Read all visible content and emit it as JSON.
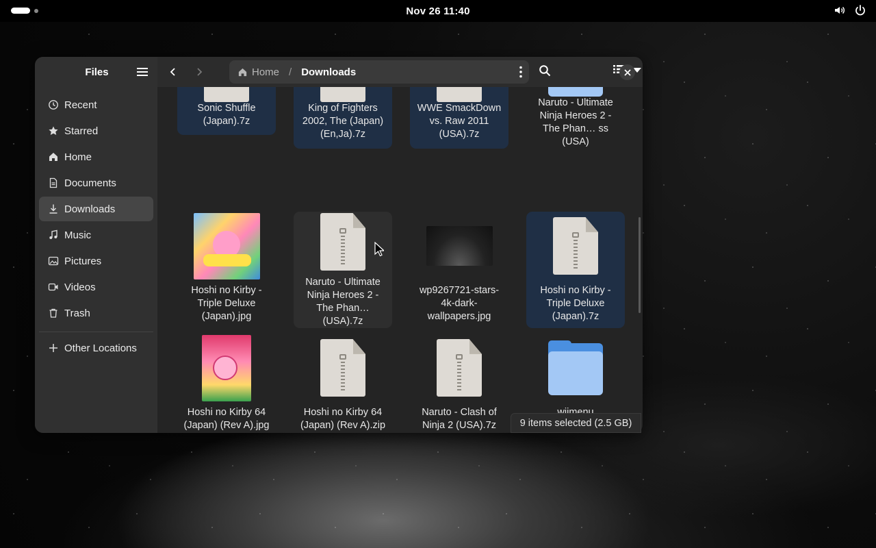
{
  "topbar": {
    "clock": "Nov 26  11:40"
  },
  "sidebar": {
    "title": "Files",
    "items": [
      {
        "label": "Recent",
        "icon": "clock-icon"
      },
      {
        "label": "Starred",
        "icon": "star-icon"
      },
      {
        "label": "Home",
        "icon": "home-icon"
      },
      {
        "label": "Documents",
        "icon": "document-icon"
      },
      {
        "label": "Downloads",
        "icon": "download-icon",
        "active": true
      },
      {
        "label": "Music",
        "icon": "music-icon"
      },
      {
        "label": "Pictures",
        "icon": "picture-icon"
      },
      {
        "label": "Videos",
        "icon": "video-icon"
      },
      {
        "label": "Trash",
        "icon": "trash-icon"
      }
    ],
    "other_locations": "Other Locations"
  },
  "header": {
    "breadcrumb_home": "Home",
    "breadcrumb_sep": "/",
    "breadcrumb_current": "Downloads"
  },
  "files": [
    {
      "label": "Sonic Shuffle (Japan).7z",
      "type": "archive",
      "selected": true
    },
    {
      "label": "King of Fighters 2002, The (Japan) (En,Ja).7z",
      "type": "archive",
      "selected": true
    },
    {
      "label": "WWE SmackDown vs. Raw 2011 (USA).7z",
      "type": "archive",
      "selected": true
    },
    {
      "label": "Naruto - Ultimate Ninja Heroes 2 - The Phan… ss (USA)",
      "type": "folder",
      "selected": false
    },
    {
      "label": "Hoshi no Kirby - Triple Deluxe (Japan).jpg",
      "type": "image",
      "selected": false
    },
    {
      "label": "Naruto - Ultimate Ninja Heroes 2 - The Phan… (USA).7z",
      "type": "archive",
      "selected": false
    },
    {
      "label": "wp9267721-stars-4k-dark-wallpapers.jpg",
      "type": "image",
      "selected": false
    },
    {
      "label": "Hoshi no Kirby - Triple Deluxe (Japan).7z",
      "type": "archive",
      "selected": true
    },
    {
      "label": "Hoshi no Kirby 64 (Japan) (Rev A).jpg",
      "type": "image",
      "selected": false
    },
    {
      "label": "Hoshi no Kirby 64 (Japan) (Rev A).zip",
      "type": "archive",
      "selected": false
    },
    {
      "label": "Naruto - Clash of Ninja 2 (USA).7z",
      "type": "archive",
      "selected": false
    },
    {
      "label": "wiimenu",
      "type": "folder",
      "selected": false
    }
  ],
  "status": {
    "text": "9 items selected  (2.5 GB)"
  }
}
